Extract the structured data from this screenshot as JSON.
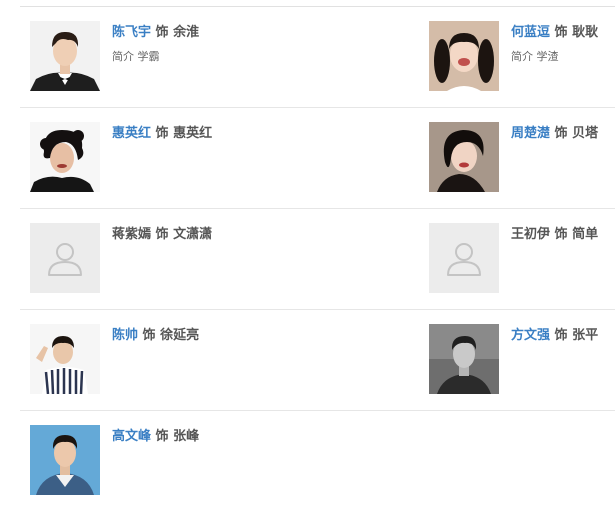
{
  "cast": [
    {
      "actor": "陈飞宇",
      "linked": true,
      "sep": "饰",
      "role": "余淮",
      "intro_label": "简介",
      "intro_text": "学霸",
      "avatar": "photo-young-man-tuxedo"
    },
    {
      "actor": "何蓝逗",
      "linked": true,
      "sep": "饰",
      "role": "耿耿",
      "intro_label": "简介",
      "intro_text": "学渣",
      "avatar": "photo-girl-pigtails"
    },
    {
      "actor": "惠英红",
      "linked": true,
      "sep": "饰",
      "role": "惠英红",
      "avatar": "photo-woman-curly-hair"
    },
    {
      "actor": "周楚濋",
      "linked": true,
      "sep": "饰",
      "role": "贝塔",
      "avatar": "photo-woman-black-hair"
    },
    {
      "actor": "蒋紫嫣",
      "linked": false,
      "sep": "饰",
      "role": "文潇潇",
      "avatar": "default-user-icon"
    },
    {
      "actor": "王初伊",
      "linked": false,
      "sep": "饰",
      "role": "简单",
      "avatar": "default-user-icon"
    },
    {
      "actor": "陈帅",
      "linked": true,
      "sep": "饰",
      "role": "徐延亮",
      "avatar": "photo-boy-striped-shirt"
    },
    {
      "actor": "方文强",
      "linked": true,
      "sep": "饰",
      "role": "张平",
      "avatar": "photo-man-grayscale"
    },
    {
      "actor": "高文峰",
      "linked": true,
      "sep": "饰",
      "role": "张峰",
      "avatar": "photo-man-denim-blue-bg"
    }
  ],
  "colors": {
    "link": "#3a7fc4",
    "text": "#555555",
    "divider": "#e6e6e6",
    "placeholder_bg": "#ececec",
    "placeholder_icon": "#c4c4c4"
  }
}
